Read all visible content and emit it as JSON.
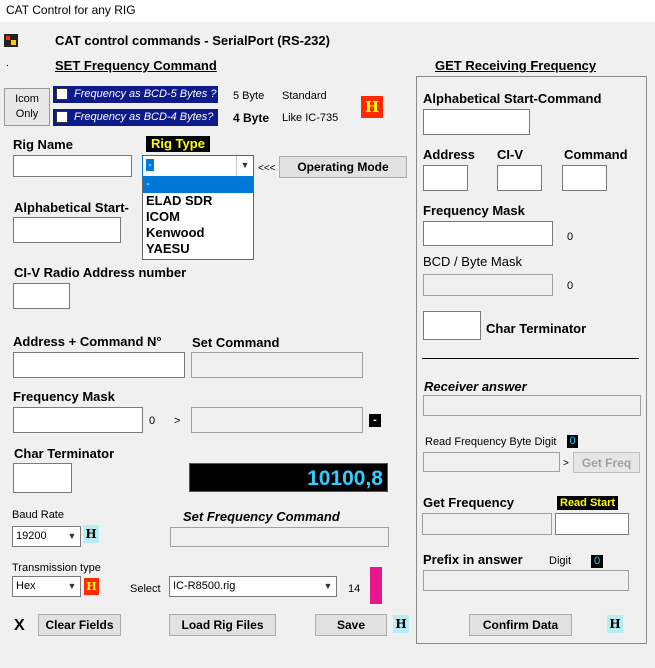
{
  "window": {
    "title": "CAT Control for any RIG"
  },
  "header": {
    "title": "CAT control commands - SerialPort (RS-232)",
    "dot": "."
  },
  "set_section": {
    "title": "SET Frequency Command",
    "icom_only": "Icom\nOnly",
    "bcd5_label": "Frequency as BCD-5 Bytes ?",
    "bcd4_label": "Frequency as BCD-4 Bytes?",
    "bcd5_count": "5 Byte",
    "bcd5_desc": "Standard",
    "bcd4_count": "4 Byte",
    "bcd4_desc": "Like IC-735",
    "h_label": "H",
    "rig_name_label": "Rig Name",
    "rig_type_label": "Rig Type",
    "rig_type_value": "-",
    "rig_type_options": [
      "-",
      "ELAD SDR",
      "ICOM",
      "Kenwood",
      "YAESU"
    ],
    "arrow_text": "<<<",
    "operating_mode_button": "Operating Mode",
    "alpha_start_label": "Alphabetical Start-",
    "civ_label": "CI-V Radio Address number",
    "addr_cmd_label": "Address + Command N°",
    "set_command_label": "Set Command",
    "freq_mask_label": "Frequency Mask",
    "freq_mask_zero": "0",
    "gt": ">",
    "minus_label": "-",
    "char_term_label": "Char Terminator",
    "freq_display": "10100,8",
    "baud_label": "Baud Rate",
    "baud_value": "19200",
    "set_freq_cmd_label": "Set Frequency Command",
    "trans_type_label": "Transmission type",
    "trans_value": "Hex",
    "select_label": "Select",
    "rig_file_value": "IC-R8500.rig",
    "rig_file_count": "14",
    "x_label": "X",
    "clear_button": "Clear Fields",
    "load_button": "Load Rig Files",
    "save_button": "Save"
  },
  "get_section": {
    "title": "GET Receiving Frequency",
    "alpha_start_label": "Alphabetical Start-Command",
    "address_label": "Address",
    "civ_label": "CI-V",
    "command_label": "Command",
    "freq_mask_label": "Frequency Mask",
    "freq_mask_zero": "0",
    "bcd_mask_label": "BCD / Byte Mask",
    "bcd_mask_zero": "0",
    "char_term_label": "Char Terminator",
    "receiver_answer_label": "Receiver answer",
    "read_byte_digit_label": "Read Frequency Byte Digit",
    "read_byte_digit_value": "0",
    "gt": ">",
    "get_freq_button": "Get Freq",
    "get_frequency_label": "Get Frequency",
    "read_start_label": "Read Start",
    "prefix_label": "Prefix in answer",
    "digit_label": "Digit",
    "digit_value": "0",
    "confirm_button": "Confirm Data",
    "h_label": "H"
  },
  "colors": {
    "accent_blue": "#0d1a8a",
    "freq_display_text": "#33ccff",
    "h_red": "#ff2a00",
    "h_yellow": "#ffff00",
    "magenta": "#e8168c",
    "h_cyan": "#b6eef3"
  }
}
